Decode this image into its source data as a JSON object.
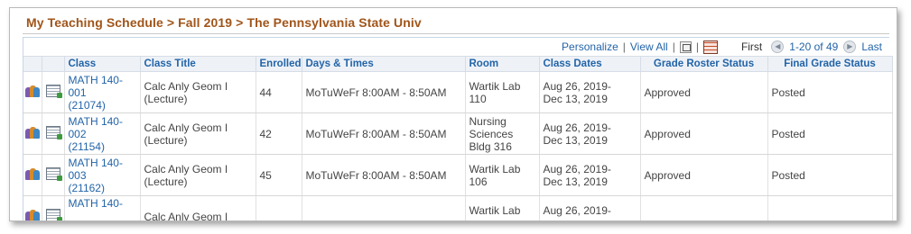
{
  "page": {
    "title": "My Teaching Schedule > Fall 2019 > The Pennsylvania State Univ"
  },
  "toolbar": {
    "personalize": "Personalize",
    "view_all": "View All",
    "first": "First",
    "count": "1-20 of 49",
    "last": "Last"
  },
  "columns": {
    "class": "Class",
    "class_title": "Class Title",
    "enrolled": "Enrolled",
    "days_times": "Days & Times",
    "room": "Room",
    "class_dates": "Class Dates",
    "grade_roster_status": "Grade Roster Status",
    "final_grade_status": "Final Grade Status"
  },
  "rows": [
    {
      "class_line1": "MATH 140-",
      "class_line2": "001",
      "class_line3": "(21074)",
      "title_line1": "Calc Anly Geom I",
      "title_line2": "(Lecture)",
      "enrolled": "44",
      "days_times": "MoTuWeFr 8:00AM - 8:50AM",
      "room_line1": "Wartik Lab",
      "room_line2": "110",
      "room_line3": "",
      "dates_line1": "Aug 26, 2019-",
      "dates_line2": "Dec 13, 2019",
      "roster_status": "Approved",
      "final_status": "Posted"
    },
    {
      "class_line1": "MATH 140-",
      "class_line2": "002",
      "class_line3": "(21154)",
      "title_line1": "Calc Anly Geom I",
      "title_line2": "(Lecture)",
      "enrolled": "42",
      "days_times": "MoTuWeFr 8:00AM - 8:50AM",
      "room_line1": "Nursing",
      "room_line2": "Sciences",
      "room_line3": "Bldg 316",
      "dates_line1": "Aug 26, 2019-",
      "dates_line2": "Dec 13, 2019",
      "roster_status": "Approved",
      "final_status": "Posted"
    },
    {
      "class_line1": "MATH 140-",
      "class_line2": "003",
      "class_line3": "(21162)",
      "title_line1": "Calc Anly Geom I",
      "title_line2": "(Lecture)",
      "enrolled": "45",
      "days_times": "MoTuWeFr 8:00AM - 8:50AM",
      "room_line1": "Wartik Lab",
      "room_line2": "106",
      "room_line3": "",
      "dates_line1": "Aug 26, 2019-",
      "dates_line2": "Dec 13, 2019",
      "roster_status": "Approved",
      "final_status": "Posted"
    },
    {
      "class_line1": "MATH 140-",
      "class_line2": "",
      "class_line3": "",
      "title_line1": "Calc Anly Geom I",
      "title_line2": "",
      "enrolled": "",
      "days_times": "",
      "room_line1": "Wartik Lab",
      "room_line2": "",
      "room_line3": "",
      "dates_line1": "Aug 26, 2019-",
      "dates_line2": "",
      "roster_status": "",
      "final_status": ""
    }
  ],
  "icons": {
    "class_roster": "class-roster-icon",
    "grade_roster": "grade-roster-icon",
    "zoom": "zoom-icon",
    "download": "download-excel-icon",
    "prev": "previous-page-icon",
    "next": "next-page-icon"
  },
  "colors": {
    "title": "#a0551a",
    "link": "#2364a8",
    "header_bg": "#eef2f7"
  }
}
